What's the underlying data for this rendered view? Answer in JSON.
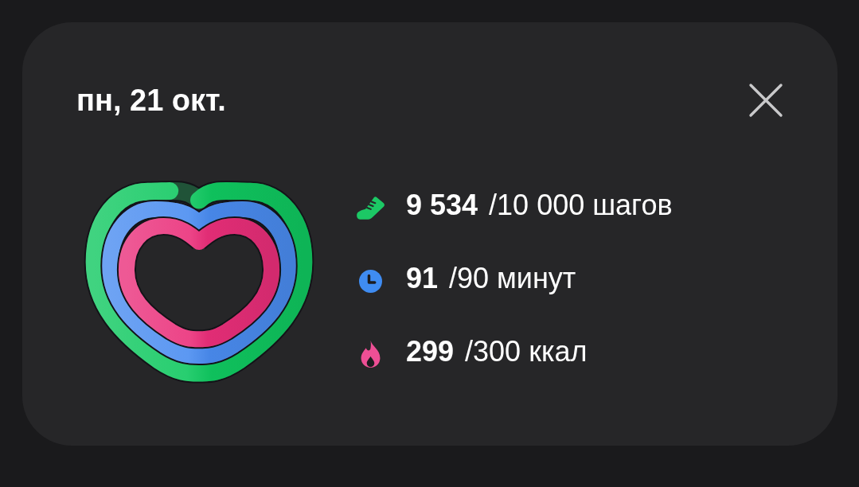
{
  "title": "пн, 21 окт.",
  "activity_rings": [
    {
      "level": 0.95,
      "color": "#10c860"
    },
    {
      "level": 1,
      "color": "#4a8cf0"
    },
    {
      "level": 1,
      "color": "#ea2f7a"
    }
  ],
  "stats": [
    {
      "kind": "steps",
      "value": "9 534",
      "goal": "/10 000 шагов",
      "color": "#1cc865"
    },
    {
      "kind": "minutes",
      "value": "91",
      "goal": "/90 минут",
      "color": "#3f8cf2"
    },
    {
      "kind": "calories",
      "value": "299",
      "goal": "/300 ккал",
      "color": "#ee4f95"
    }
  ]
}
